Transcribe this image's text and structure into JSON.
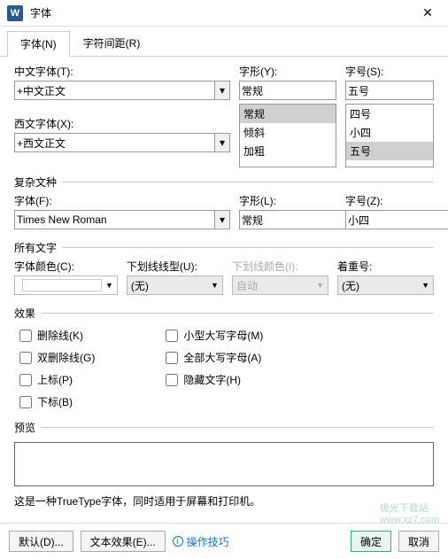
{
  "window": {
    "title": "字体"
  },
  "tabs": {
    "font": "字体(N)",
    "spacing": "字符间距(R)"
  },
  "section1": {
    "cn_font_label": "中文字体(T):",
    "cn_font_value": "+中文正文",
    "latin_font_label": "西文字体(X):",
    "latin_font_value": "+西文正文",
    "style_label": "字形(Y):",
    "style_value": "常规",
    "style_options": [
      "常规",
      "倾斜",
      "加粗"
    ],
    "size_label": "字号(S):",
    "size_value": "五号",
    "size_options": [
      "四号",
      "小四",
      "五号"
    ]
  },
  "complex": {
    "legend": "复杂文种",
    "font_label": "字体(F):",
    "font_value": "Times New Roman",
    "style_label": "字形(L):",
    "style_value": "常规",
    "size_label": "字号(Z):",
    "size_value": "小四"
  },
  "all_text": {
    "legend": "所有文字",
    "color_label": "字体颜色(C):",
    "underline_label": "下划线线型(U):",
    "underline_value": "(无)",
    "underline_color_label": "下划线颜色(I):",
    "underline_color_value": "自动",
    "emphasis_label": "着重号:",
    "emphasis_value": "(无)"
  },
  "effects": {
    "legend": "效果",
    "strike": "删除线(K)",
    "double_strike": "双删除线(G)",
    "superscript": "上标(P)",
    "subscript": "下标(B)",
    "smallcaps": "小型大写字母(M)",
    "allcaps": "全部大写字母(A)",
    "hidden": "隐藏文字(H)"
  },
  "preview": {
    "legend": "预览"
  },
  "info_text": "这是一种TrueType字体，同时适用于屏幕和打印机。",
  "footer": {
    "default": "默认(D)...",
    "text_effect": "文本效果(E)...",
    "tips": "操作技巧",
    "ok": "确定",
    "cancel": "取消"
  },
  "watermark": {
    "line1": "极光下载站",
    "line2": "www.xz7.com"
  }
}
